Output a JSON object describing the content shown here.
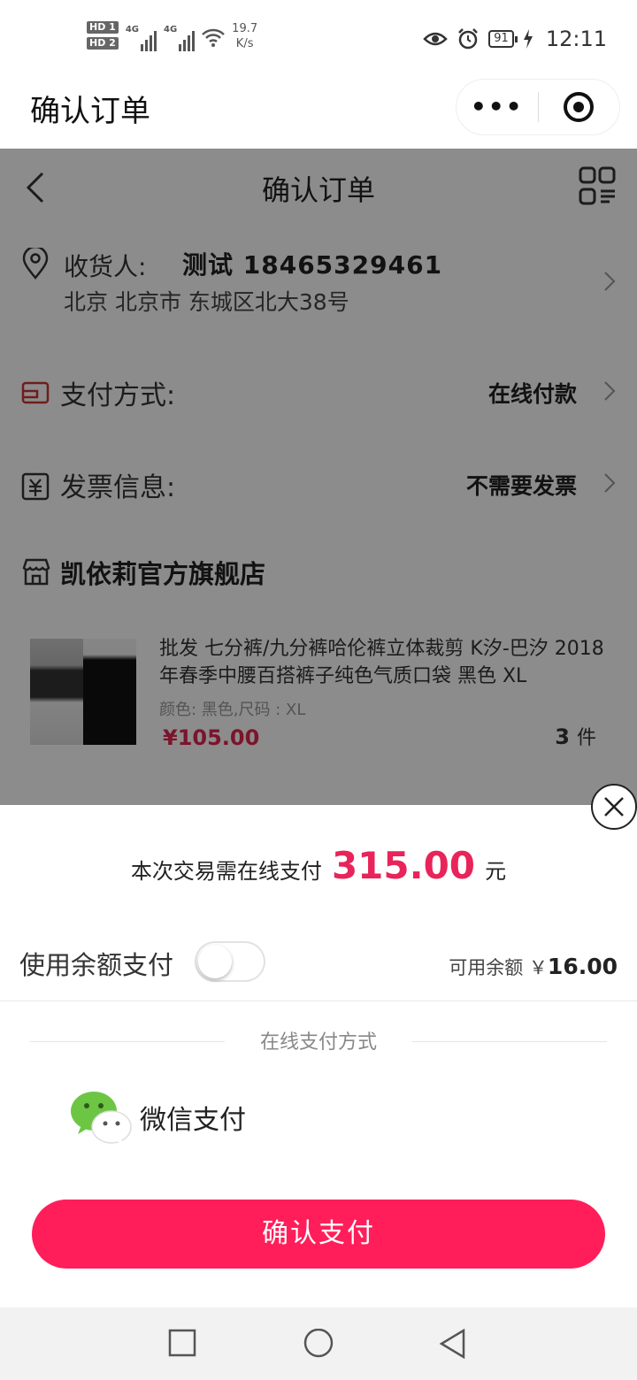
{
  "status_bar": {
    "sim1": "HD 1",
    "sim2": "HD 2",
    "net1": "4G",
    "net2": "4G",
    "speed_value": "19.7",
    "speed_unit": "K/s",
    "battery": "91",
    "time": "12:11"
  },
  "miniapp_nav": {
    "title": "确认订单",
    "more_label": "•••"
  },
  "page": {
    "title": "确认订单",
    "address": {
      "label": "收货人:",
      "name_phone": "测试  18465329461",
      "detail": "北京 北京市 东城区北大38号"
    },
    "payment_method": {
      "label": "支付方式:",
      "value": "在线付款"
    },
    "invoice": {
      "label": "发票信息:",
      "value": "不需要发票"
    },
    "store_name": "凯依莉官方旗舰店",
    "product": {
      "title": "批发 七分裤/九分裤哈伦裤立体裁剪 K汐-巴汐 2018年春季中腰百搭裤子纯色气质口袋 黑色 XL",
      "spec": "颜色: 黑色,尺码 : XL",
      "price": "¥105.00",
      "qty": "3",
      "qty_unit": "件"
    }
  },
  "payment_sheet": {
    "amount_prefix": "本次交易需在线支付",
    "amount": "315.00",
    "amount_unit": "元",
    "balance_label": "使用余额支付",
    "balance_toggle_on": false,
    "available_label": "可用余额",
    "available_currency": "￥",
    "available_value": "16.00",
    "online_methods_title": "在线支付方式",
    "wechat_label": "微信支付",
    "confirm_label": "确认支付"
  },
  "colors": {
    "accent": "#ff1e5a",
    "amount": "#e8245a",
    "price": "#e02650"
  }
}
